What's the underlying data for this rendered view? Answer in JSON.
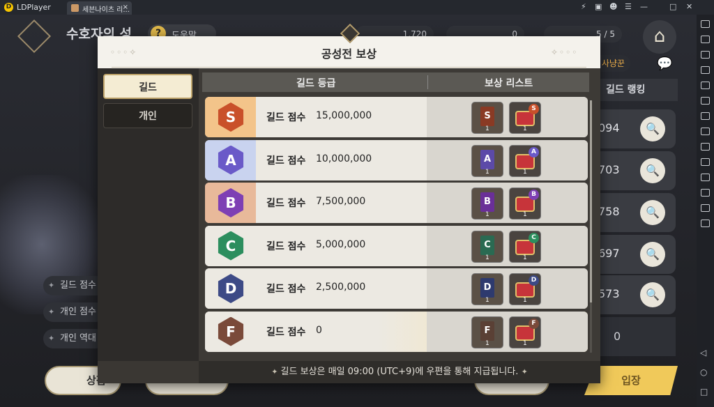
{
  "emulator": {
    "app_name": "LDPlayer",
    "tab_label": "세븐나이츠 리...",
    "tab_close": "×",
    "controls": [
      "⚡",
      "▣",
      "☻",
      "☰",
      "—",
      "□",
      "✕"
    ]
  },
  "game": {
    "title": "수호자의 성",
    "help_icon": "?",
    "help_label": "도움말",
    "resources": [
      {
        "value": "1,720",
        "icon": "ruby-icon"
      },
      {
        "value": "0",
        "icon": "coin-icon"
      },
      {
        "value": "5 / 5",
        "icon": "ticket-icon"
      }
    ],
    "notice": "금 사냥꾼",
    "rank_tab": "길드 랭킹",
    "rank_rows": [
      "094",
      "703",
      "758",
      "697",
      "573"
    ],
    "rank_empty": "0",
    "left_rows": [
      "길드 점수",
      "개인 점수",
      "개인 역대"
    ],
    "bottom_buttons": [
      "상점",
      "",
      ""
    ],
    "enter_label": "입장"
  },
  "modal": {
    "title": "공성전 보상",
    "tabs": [
      {
        "label": "길드",
        "active": true
      },
      {
        "label": "개인",
        "active": false
      }
    ],
    "col_grade": "길드 등급",
    "col_rewards": "보상 리스트",
    "rows": [
      {
        "grade": "S",
        "label": "길드 점수",
        "score": "15,000,000",
        "color": "#c9502a",
        "bg": "#f3c48a",
        "card": "#8a3a24",
        "card_count": "1",
        "chest_count": "1"
      },
      {
        "grade": "A",
        "label": "길드 점수",
        "score": "10,000,000",
        "color": "#6a5ac8",
        "bg": "#c9d3ef",
        "card": "#5c4aa8",
        "card_count": "1",
        "chest_count": "1"
      },
      {
        "grade": "B",
        "label": "길드 점수",
        "score": "7,500,000",
        "color": "#7e3fb4",
        "bg": "#e8b99a",
        "card": "#6a2f98",
        "card_count": "1",
        "chest_count": "1"
      },
      {
        "grade": "C",
        "label": "길드 점수",
        "score": "5,000,000",
        "color": "#2c8e5e",
        "bg": "#ece9e2",
        "card": "#2a6a52",
        "card_count": "1",
        "chest_count": "1"
      },
      {
        "grade": "D",
        "label": "길드 점수",
        "score": "2,500,000",
        "color": "#3d4a86",
        "bg": "#ece9e2",
        "card": "#2e3a6e",
        "card_count": "1",
        "chest_count": "1"
      },
      {
        "grade": "F",
        "label": "길드 점수",
        "score": "0",
        "color": "#7a4a3a",
        "bg": "#ece9e2",
        "card": "#5a4035",
        "card_count": "1",
        "chest_count": "1"
      }
    ],
    "footer": "길드 보상은 매일 09:00 (UTC+9)에 우편을 통해 지급됩니다."
  }
}
